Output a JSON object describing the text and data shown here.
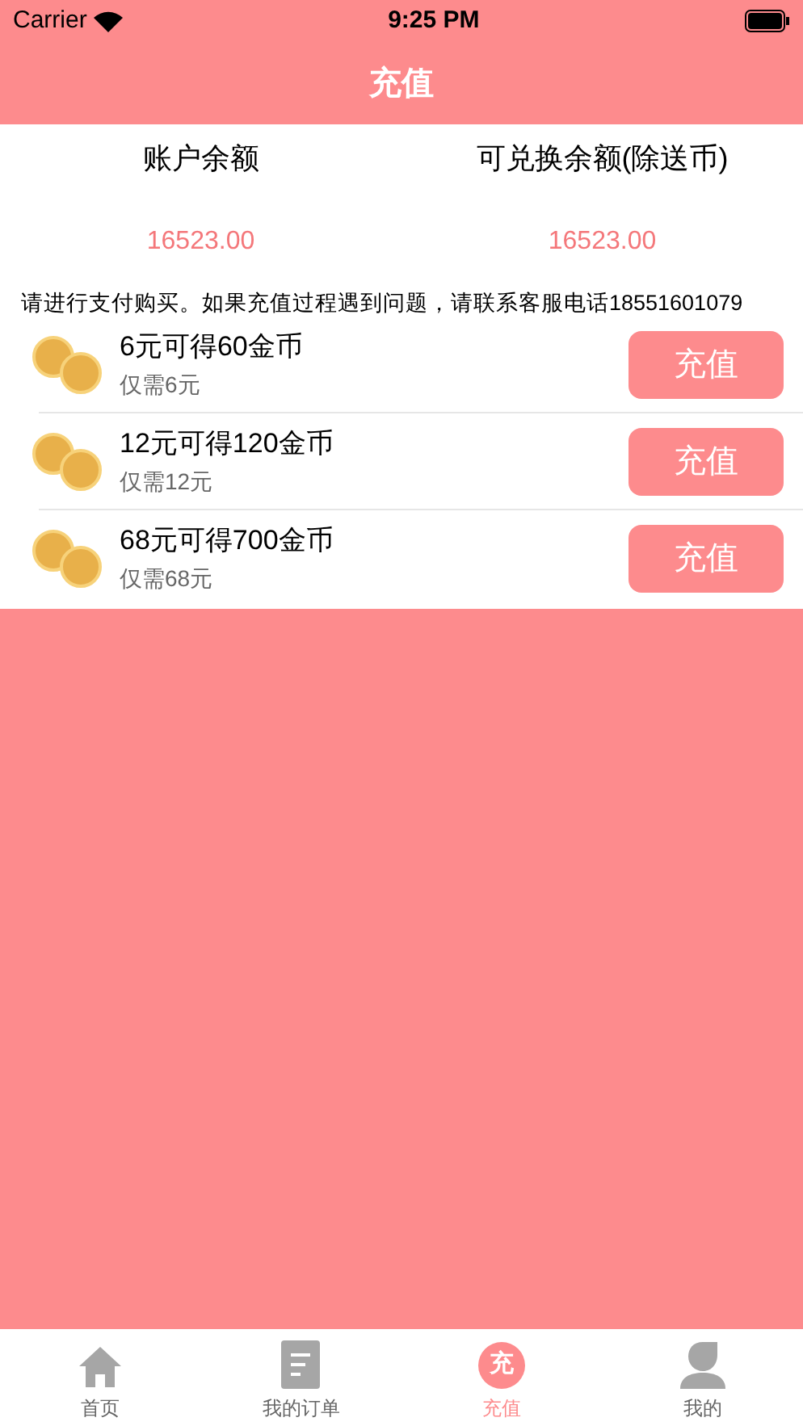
{
  "status_bar": {
    "carrier": "Carrier",
    "time": "9:25 PM"
  },
  "nav": {
    "title": "充值"
  },
  "balances": [
    {
      "label": "账户余额",
      "value": "16523.00"
    },
    {
      "label": "可兑换余额(除送币)",
      "value": "16523.00"
    }
  ],
  "notice": "请进行支付购买。如果充值过程遇到问题，请联系客服电话18551601079",
  "packages": [
    {
      "title": "6元可得60金币",
      "price": "仅需6元",
      "button": "充值"
    },
    {
      "title": "12元可得120金币",
      "price": "仅需12元",
      "button": "充值"
    },
    {
      "title": "68元可得700金币",
      "price": "仅需68元",
      "button": "充值"
    }
  ],
  "tabs": [
    {
      "kind": "home",
      "label": "首页",
      "selected": false
    },
    {
      "kind": "document",
      "label": "我的订单",
      "selected": false
    },
    {
      "kind": "badge",
      "badge_text": "充",
      "label": "充值",
      "selected": true
    },
    {
      "kind": "person",
      "label": "我的",
      "selected": false
    }
  ]
}
